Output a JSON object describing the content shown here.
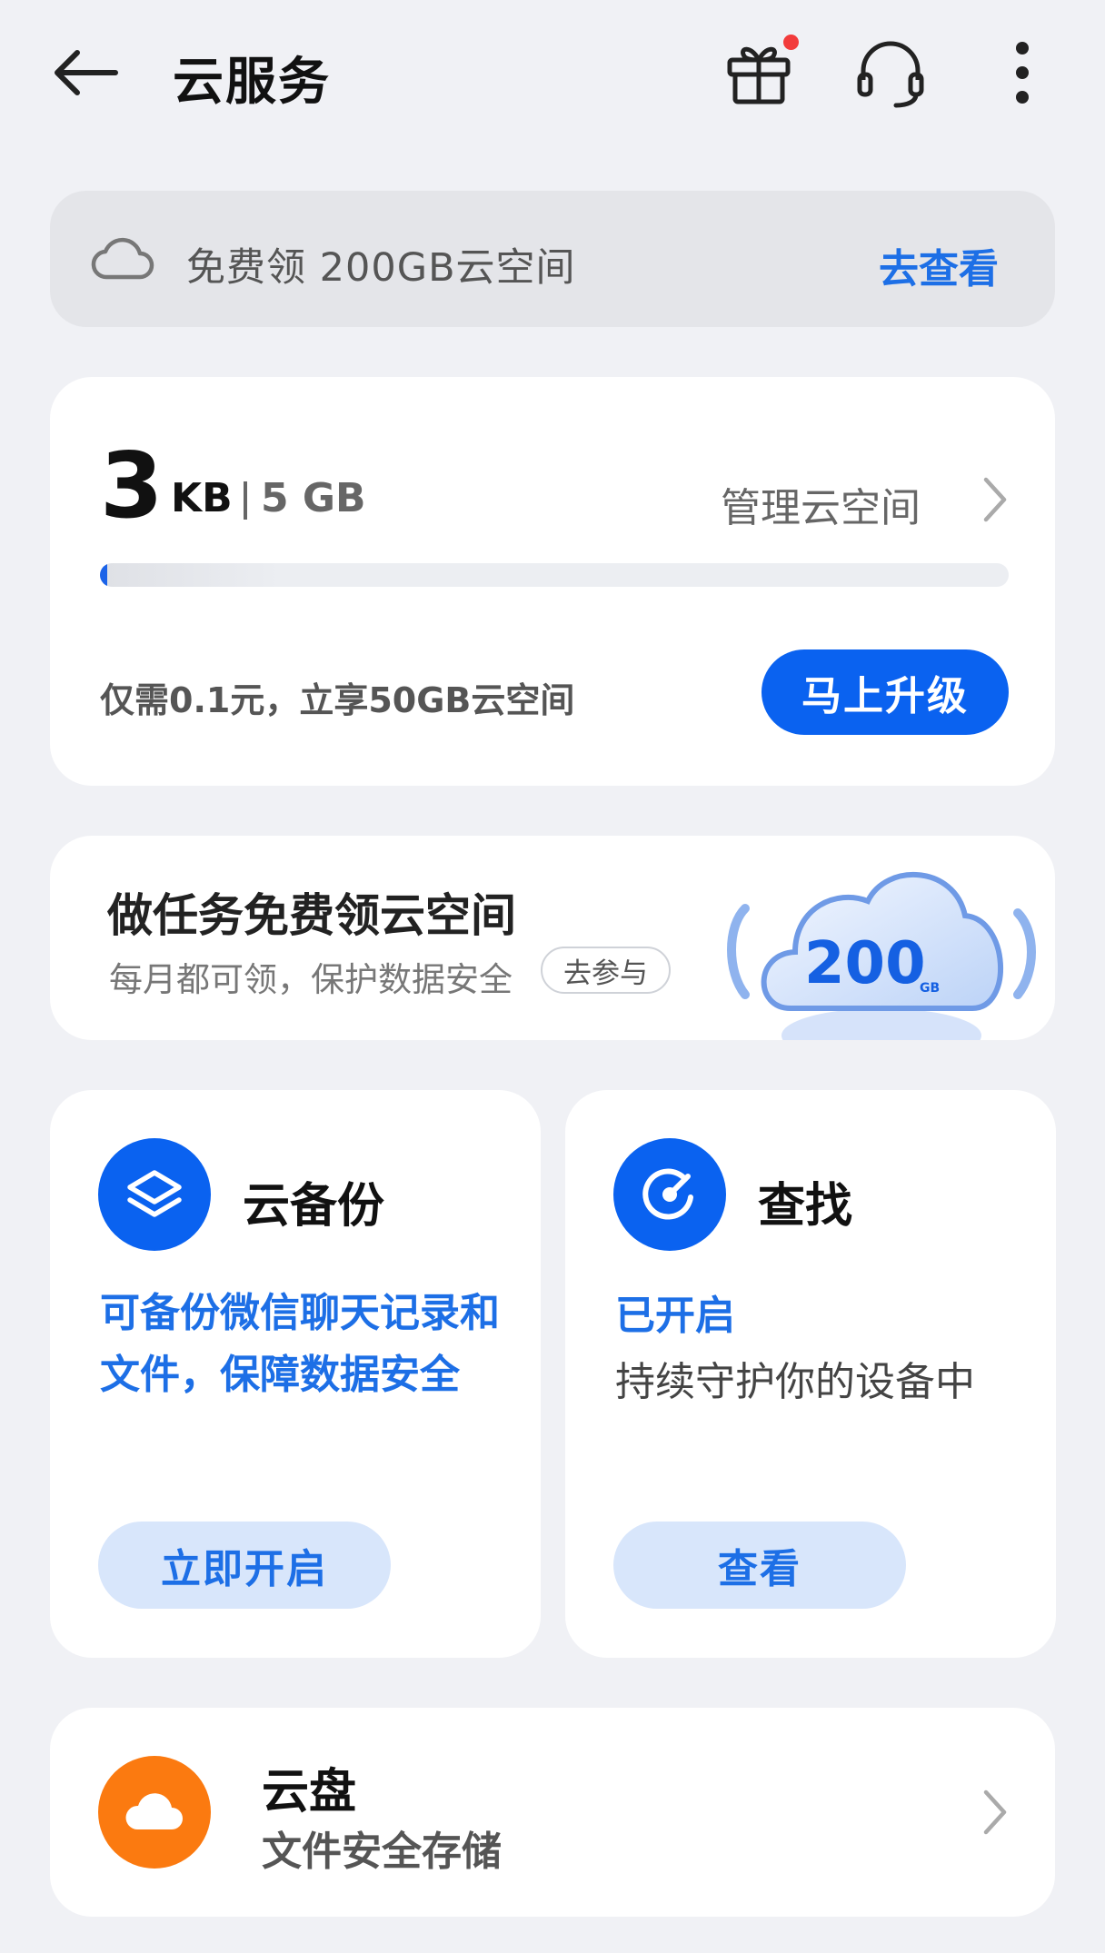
{
  "header": {
    "title": "云服务",
    "icons": [
      "back-arrow-icon",
      "gift-icon",
      "headset-icon",
      "more-vertical-icon"
    ],
    "gift_has_notification": true
  },
  "promo": {
    "text": "免费领 200GB云空间",
    "link": "去查看",
    "icon": "cloud-outline-icon"
  },
  "storage": {
    "used_value": "3",
    "used_unit": "KB",
    "total": "5 GB",
    "manage_label": "管理云空间",
    "offer_text": "仅需0.1元，立享50GB云空间",
    "upgrade_label": "马上升级"
  },
  "task": {
    "title": "做任务免费领云空间",
    "subtitle": "每月都可领，保护数据安全",
    "button": "去参与",
    "illustration_value": "200",
    "illustration_unit": "GB"
  },
  "backup": {
    "title": "云备份",
    "description": "可备份微信聊天记录和文件，保障数据安全",
    "button": "立即开启",
    "icon": "layers-icon"
  },
  "find": {
    "title": "查找",
    "status": "已开启",
    "description": "持续守护你的设备中",
    "button": "查看",
    "icon": "radar-icon"
  },
  "disk": {
    "title": "云盘",
    "subtitle": "文件安全存储",
    "icon": "cloud-filled-icon"
  },
  "colors": {
    "accent": "#0a62f0",
    "link": "#1d6fe6",
    "orange": "#fb7a10",
    "notification": "#f23b3b",
    "background": "#f0f1f5"
  }
}
